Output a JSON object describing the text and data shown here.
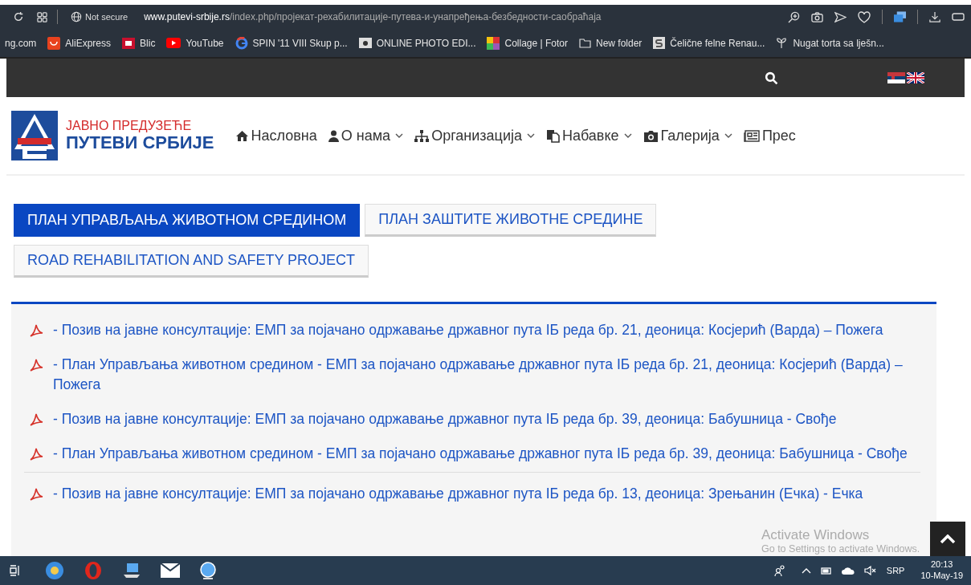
{
  "browser": {
    "security": "Not secure",
    "url_domain": "www.putevi-srbije.rs",
    "url_path": "/index.php/пројекат-рехабилитације-путева-и-унапређења-безбедности-саобраћаја"
  },
  "bookmarks": [
    {
      "label": "ng.com",
      "kind": "none"
    },
    {
      "label": "AliExpress",
      "kind": "ali"
    },
    {
      "label": "Blic",
      "kind": "blic"
    },
    {
      "label": "YouTube",
      "kind": "youtube"
    },
    {
      "label": "SPIN '11 VIII Skup p...",
      "kind": "google"
    },
    {
      "label": "ONLINE PHOTO EDI...",
      "kind": "photo"
    },
    {
      "label": "Collage | Fotor",
      "kind": "fotor"
    },
    {
      "label": "New folder",
      "kind": "folder"
    },
    {
      "label": "Čelične felne Renau...",
      "kind": "s"
    },
    {
      "label": "Nugat torta sa lješn...",
      "kind": "plant"
    }
  ],
  "logo": {
    "line_1": "ЈАВНО ПРЕДУЗЕЋЕ",
    "line_2": "ПУТЕВИ СРБИЈЕ"
  },
  "nav": [
    {
      "label": "Насловна",
      "kind": "home",
      "dropdown": false
    },
    {
      "label": "О нама",
      "kind": "about",
      "dropdown": true
    },
    {
      "label": "Организација",
      "kind": "organization",
      "dropdown": true
    },
    {
      "label": "Набавке",
      "kind": "procurement",
      "dropdown": true
    },
    {
      "label": "Галерија",
      "kind": "gallery",
      "dropdown": true
    },
    {
      "label": "Прес",
      "kind": "press",
      "dropdown": false
    }
  ],
  "tabs": [
    {
      "label": "ПЛАН УПРАВЉАЊА ЖИВОТНОМ СРЕДИНОМ",
      "selected": true
    },
    {
      "label": "ПЛАН ЗАШТИТЕ ЖИВОТНЕ СРЕДИНЕ",
      "selected": false
    },
    {
      "label": "ROAD REHABILITATION AND SAFETY PROJECT",
      "selected": false
    }
  ],
  "documents": [
    {
      "title": "- Позив на јавне консултације: ЕМП за појачано одржавање државног пута IБ реда бр. 21, деоница: Косјерић (Варда) – Пожега",
      "divider_before": false
    },
    {
      "title": "- План Управљања животном средином - ЕМП за појачано одржавање државног пута IБ реда бр. 21, деоница: Косјерић (Варда) – Пожега",
      "divider_before": false
    },
    {
      "title": "- Позив на јавне консултације: ЕМП за појачано одржавање државног пута IБ реда бр. 39, деоница: Бабушница - Свође",
      "divider_before": false
    },
    {
      "title": "- План Управљања животном средином - ЕМП за појачано одржавање државног пута IБ реда бр. 39, деоница: Бабушница - Свође",
      "divider_before": false
    },
    {
      "title": "- Позив на јавне консултације: ЕМП за појачано одржавање државног пута IБ реда бр. 13, деоница: Зрењанин (Ечка) - Ечка",
      "divider_before": true
    }
  ],
  "watermark": {
    "line_1": "Activate Windows",
    "line_2": "Go to Settings to activate Windows."
  },
  "taskbar": {
    "language": "SRP",
    "time": "20:13",
    "date": "10-May-19"
  }
}
